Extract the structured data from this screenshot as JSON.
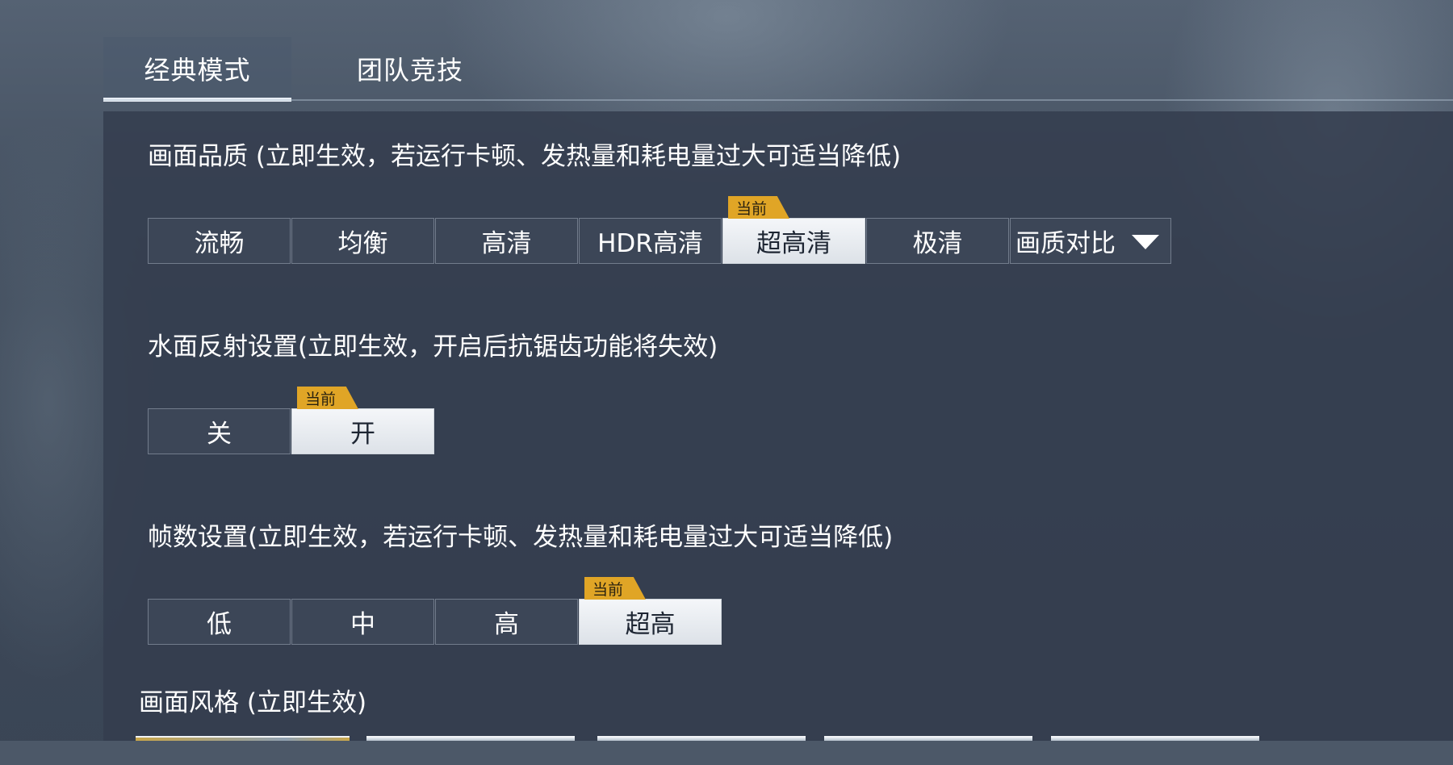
{
  "tabs": [
    {
      "label": "经典模式",
      "active": true
    },
    {
      "label": "团队竞技",
      "active": false
    }
  ],
  "graphics_quality": {
    "title": "画面品质 (立即生效，若运行卡顿、发热量和耗电量过大可适当降低)",
    "options": [
      "流畅",
      "均衡",
      "高清",
      "HDR高清",
      "超高清",
      "极清"
    ],
    "selected": "超高清",
    "compare_label": "画质对比"
  },
  "water_reflection": {
    "title": "水面反射设置(立即生效，开启后抗锯齿功能将失效)",
    "options": [
      "关",
      "开"
    ],
    "selected": "开"
  },
  "frame_rate": {
    "title": "帧数设置(立即生效，若运行卡顿、发热量和耗电量过大可适当降低)",
    "options": [
      "低",
      "中",
      "高",
      "超高"
    ],
    "selected": "超高"
  },
  "picture_style": {
    "title": "画面风格 (立即生效)"
  },
  "current_tag": "当前",
  "colors": {
    "tag": "#e0a526",
    "selected_bg": "#eef1f5",
    "button_bg": "#3c4657",
    "panel_bg": "#343e4e"
  }
}
